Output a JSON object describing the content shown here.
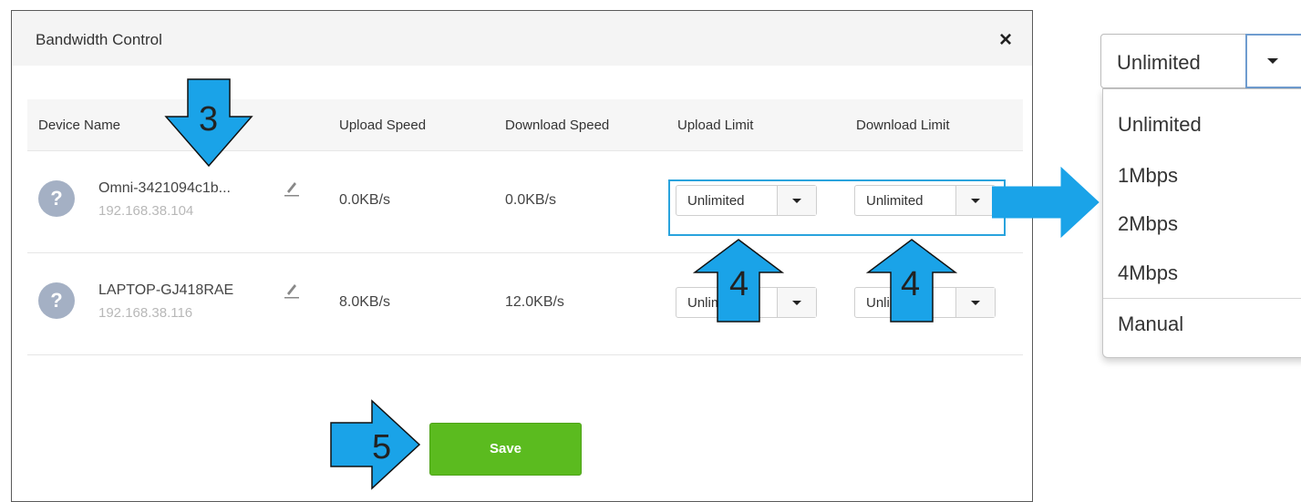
{
  "modal": {
    "title": "Bandwidth Control",
    "close_label": "×"
  },
  "table": {
    "headers": [
      "Device Name",
      "Upload Speed",
      "Download Speed",
      "Upload Limit",
      "Download Limit"
    ],
    "rows": [
      {
        "avatar": "?",
        "name": "Omni-3421094c1b...",
        "ip": "192.168.38.104",
        "upload_speed": "0.0KB/s",
        "download_speed": "0.0KB/s",
        "upload_limit": "Unlimited",
        "download_limit": "Unlimited"
      },
      {
        "avatar": "?",
        "name": "LAPTOP-GJ418RAE",
        "ip": "192.168.38.116",
        "upload_speed": "8.0KB/s",
        "download_speed": "12.0KB/s",
        "upload_limit": "Unlimited",
        "download_limit": "Unlimited"
      }
    ]
  },
  "save_label": "Save",
  "dropdown": {
    "selected": "Unlimited",
    "options": [
      "Unlimited",
      "1Mbps",
      "2Mbps",
      "4Mbps",
      "Manual"
    ]
  },
  "callouts": {
    "step3": "3",
    "step4a": "4",
    "step4b": "4",
    "step5": "5"
  },
  "colors": {
    "save_green": "#5bbb1f",
    "callout_blue": "#1aa3e8",
    "highlight_border": "#29a3dd",
    "avatar_gray": "#a4b0c4"
  }
}
